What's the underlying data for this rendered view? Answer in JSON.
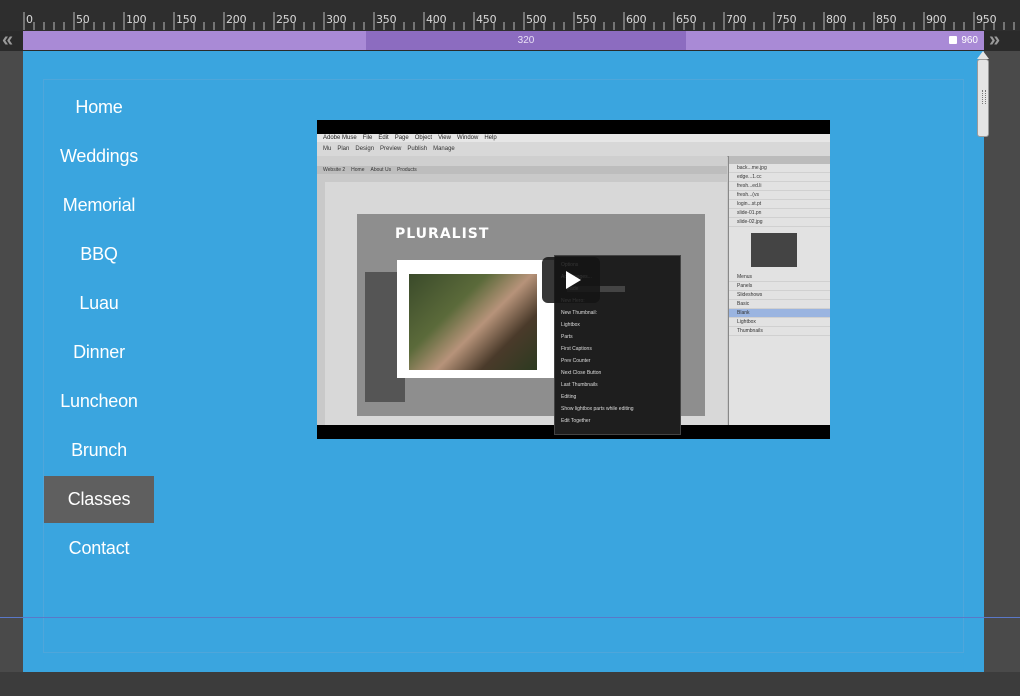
{
  "ruler": {
    "ticks": [
      "0",
      "50",
      "100",
      "150",
      "200",
      "250",
      "300",
      "350",
      "400",
      "450",
      "500",
      "550",
      "600",
      "650",
      "700",
      "750",
      "800",
      "850",
      "900",
      "950"
    ]
  },
  "breakpoints": {
    "left_chevron": "«",
    "right_chevron": "»",
    "middle_label": "320",
    "right_label": "960"
  },
  "nav": {
    "items": [
      {
        "label": "Home",
        "active": false
      },
      {
        "label": "Weddings",
        "active": false
      },
      {
        "label": "Memorial",
        "active": false
      },
      {
        "label": "BBQ",
        "active": false
      },
      {
        "label": "Luau",
        "active": false
      },
      {
        "label": "Dinner",
        "active": false
      },
      {
        "label": "Luncheon",
        "active": false
      },
      {
        "label": "Brunch",
        "active": false
      },
      {
        "label": "Classes",
        "active": true
      },
      {
        "label": "Contact",
        "active": false
      }
    ]
  },
  "video": {
    "app_title": "Adobe Muse",
    "menu": [
      "Adobe Muse",
      "File",
      "Edit",
      "Page",
      "Object",
      "View",
      "Window",
      "Help"
    ],
    "toolbar": [
      "Mu",
      "Plan",
      "Design",
      "Preview",
      "Publish",
      "Manage"
    ],
    "tabs": [
      "Website 2",
      "Home",
      "About Us",
      "Products"
    ],
    "site_title": "PLURALIST",
    "dialog": {
      "options_label": "Options",
      "add_images": "Add Images...",
      "transition_value": "Fade",
      "new_hero": "New Hero:",
      "new_thumbnail": "New Thumbnail:",
      "lightbox": "Lightbox",
      "parts_label": "Parts",
      "parts": [
        "First",
        "Captions",
        "Prev",
        "Counter",
        "Next",
        "Close Button",
        "Last",
        "Thumbnails"
      ],
      "editing_label": "Editing",
      "editing_items": [
        "Show lightbox parts while editing",
        "Edit Together"
      ]
    },
    "right_panel": {
      "assets": [
        "back...me.jpg",
        "edge...1.cc",
        "fresh...ed.li",
        "fresh...(vs",
        "login...st.pt",
        "slide-01.pn",
        "slide-02.jpg"
      ],
      "widgets": [
        "Menus",
        "Panels",
        "Slideshows",
        "Basic",
        "Blank",
        "Lightbox",
        "Thumbnails"
      ]
    }
  }
}
